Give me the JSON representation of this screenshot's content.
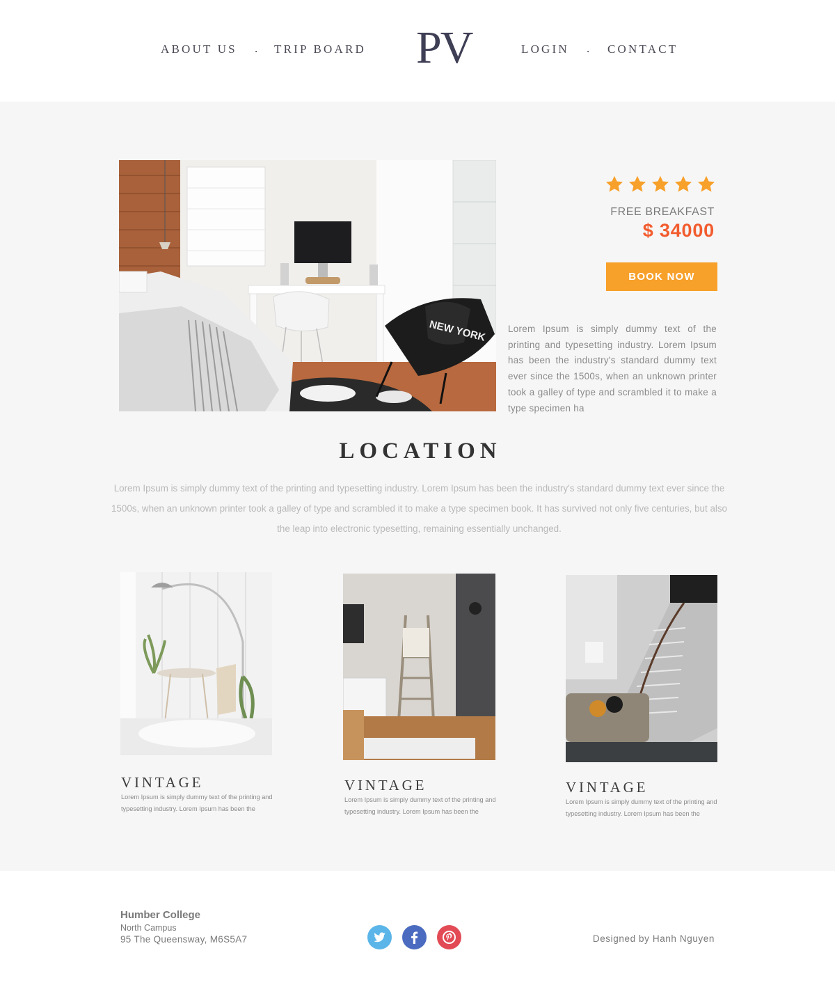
{
  "nav": {
    "left": [
      {
        "label": "ABOUT US"
      },
      {
        "label": "TRIP BOARD"
      }
    ],
    "separator": ".",
    "logo": "PV",
    "right": [
      {
        "label": "LOGIN"
      },
      {
        "label": "CONTACT"
      }
    ]
  },
  "hero": {
    "rating": 5,
    "perk": "FREE BREAKFAST",
    "price": "$ 34000",
    "book_label": "BOOK NOW",
    "description": "Lorem Ipsum is simply dummy text of the printing and typesetting industry. Lorem Ipsum has been the industry's standard dummy text ever since the 1500s, when an unknown printer took a galley of type and scrambled it to make a type specimen ha"
  },
  "location": {
    "title": "LOCATION",
    "text": "Lorem Ipsum is simply dummy text of the printing and typesetting industry. Lorem Ipsum has been the industry's standard dummy text ever since the 1500s, when an unknown printer took a galley of type and scrambled it to make a type specimen book. It has survived not only five centuries, but also the leap into electronic typesetting, remaining essentially unchanged."
  },
  "cards": [
    {
      "title": "VINTAGE",
      "text": "Lorem Ipsum is simply dummy text of the printing and typesetting industry. Lorem Ipsum has been the"
    },
    {
      "title": "VINTAGE",
      "text": "Lorem Ipsum is simply dummy text of the printing and typesetting industry. Lorem Ipsum has been the"
    },
    {
      "title": "VINTAGE",
      "text": "Lorem Ipsum is simply dummy text of the printing and typesetting industry. Lorem Ipsum has been the"
    }
  ],
  "footer": {
    "org": "Humber College",
    "campus": "North Campus",
    "address": "95 The Queensway, M6S5A7",
    "credit": "Designed by Hanh Nguyen",
    "social": [
      {
        "icon": "twitter-icon",
        "color": "#5bb5e8"
      },
      {
        "icon": "facebook-icon",
        "color": "#4a6bbf"
      },
      {
        "icon": "pinterest-icon",
        "color": "#e24b55"
      }
    ]
  },
  "colors": {
    "accent": "#f7a02a",
    "price": "#f25c2e",
    "logo": "#3e3e55",
    "background": "#f6f6f6"
  }
}
